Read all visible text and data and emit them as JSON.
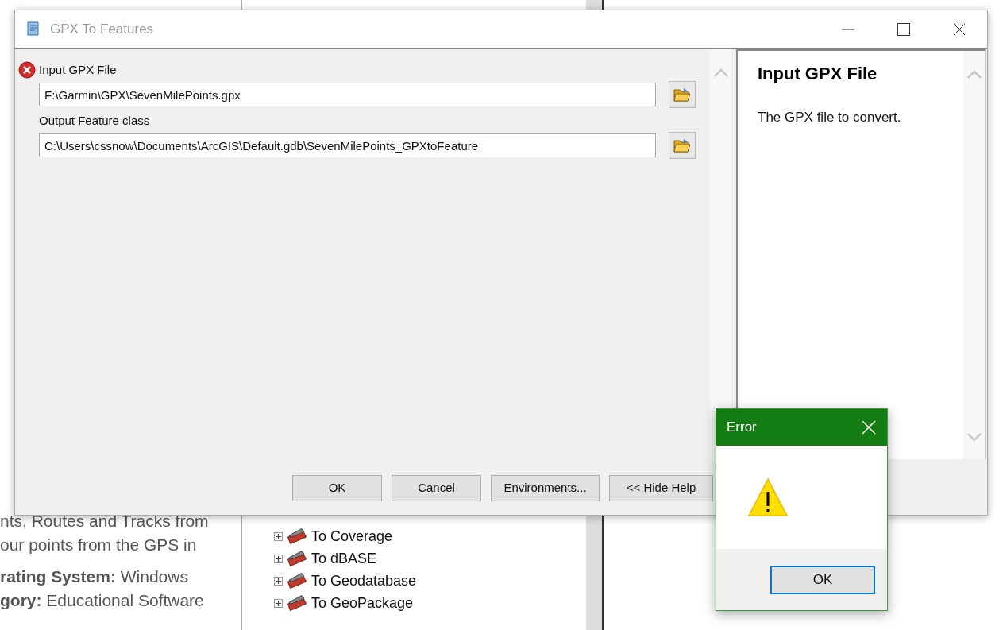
{
  "background_page": {
    "lines": [
      "nts, Routes and Tracks from",
      "our points from the GPS in",
      "**rating System:** Windows",
      "**gory:** Educational Software"
    ]
  },
  "toolbox_tree": {
    "items": [
      {
        "label": "To Coverage",
        "expanded": false
      },
      {
        "label": "To dBASE",
        "expanded": false
      },
      {
        "label": "To Geodatabase",
        "expanded": false
      },
      {
        "label": "To GeoPackage",
        "expanded": false
      }
    ]
  },
  "dialog": {
    "title": "GPX To Features",
    "parameters": [
      {
        "label": "Input GPX File",
        "value": "F:\\Garmin\\GPX\\SevenMilePoints.gpx",
        "error": true
      },
      {
        "label": "Output Feature class",
        "value": "C:\\Users\\cssnow\\Documents\\ArcGIS\\Default.gdb\\SevenMilePoints_GPXtoFeature",
        "error": false
      }
    ],
    "buttons": [
      "OK",
      "Cancel",
      "Environments...",
      "<< Hide Help"
    ],
    "help": {
      "title": "Input GPX File",
      "text": "The GPX file to convert."
    }
  },
  "error_dialog": {
    "title": "Error",
    "button": "OK"
  }
}
